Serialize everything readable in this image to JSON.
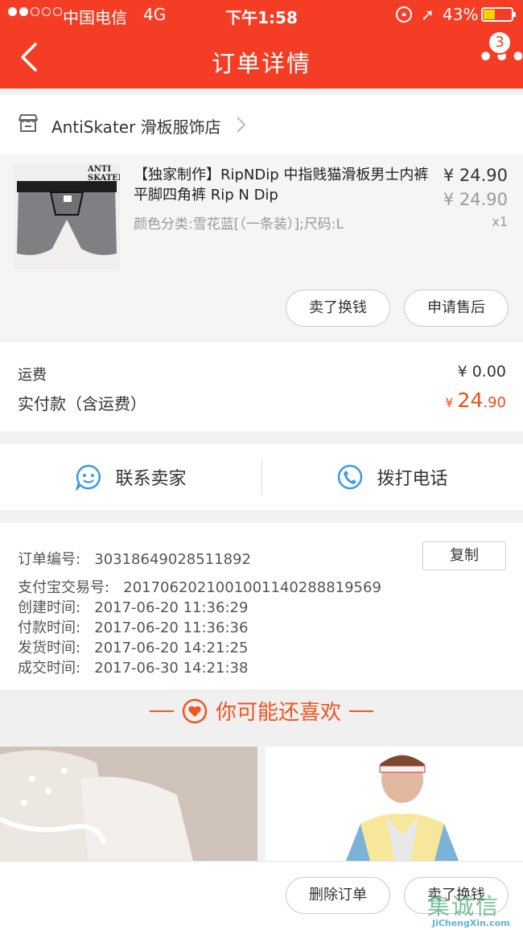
{
  "status_bar": {
    "carrier": "中国电信",
    "network": "4G",
    "time": "下午1:58",
    "battery": "43%",
    "icons": [
      "signal-dots-icon",
      "rotation-lock-icon",
      "location-arrow-icon",
      "battery-icon"
    ]
  },
  "nav": {
    "title": "订单详情",
    "badge_count": "3",
    "icons": [
      "back-chevron-icon",
      "more-dots-icon"
    ]
  },
  "shop": {
    "name": "AntiSkater 滑板服饰店",
    "icons": [
      "store-icon",
      "chevron-right-icon"
    ]
  },
  "product": {
    "image_brand_text": "ANTI SKATER",
    "title": "【独家制作】RipNDip 中指贱猫滑板男士内裤平脚四角裤 Rip N Dip",
    "sku": "颜色分类:雪花蓝[（一条装）];尺码:L",
    "price": "¥ 24.90",
    "original_price": "¥ 24.90",
    "quantity": "x1",
    "buttons": {
      "sell": "卖了换钱",
      "after_sale": "申请售后"
    }
  },
  "totals": {
    "shipping_label": "运费",
    "shipping_value": "¥ 0.00",
    "paid_label": "实付款（含运费）",
    "paid_symbol": "¥",
    "paid_int": "24",
    "paid_dec": ".90",
    "accent_color": "#f04d1b"
  },
  "contact": {
    "seller_label": "联系卖家",
    "phone_label": "拨打电话",
    "icons": [
      "chat-bubble-icon",
      "phone-icon"
    ],
    "icon_color": "#3a9be6"
  },
  "order_info": {
    "copy_label": "复制",
    "rows": [
      {
        "label": "订单编号:",
        "value": "30318649028511892"
      },
      {
        "label": "支付宝交易号:",
        "value": "2017062021001001140288819569"
      },
      {
        "label": "创建时间:",
        "value": "2017-06-20 11:36:29"
      },
      {
        "label": "付款时间:",
        "value": "2017-06-20 11:36:36"
      },
      {
        "label": "发货时间:",
        "value": "2017-06-20 14:21:25"
      },
      {
        "label": "成交时间:",
        "value": "2017-06-30 14:21:38"
      }
    ]
  },
  "recommend": {
    "title": "你可能还喜欢",
    "icons": [
      "heart-icon"
    ],
    "accent_color": "#f0551f"
  },
  "bottom_bar": {
    "delete_label": "删除订单",
    "sell_label": "卖了换钱"
  },
  "watermark": {
    "cn": "集诚信",
    "en": "JiChengXin.com"
  },
  "colors": {
    "header": "#f53d25",
    "battery_fill": "#ffd200"
  }
}
